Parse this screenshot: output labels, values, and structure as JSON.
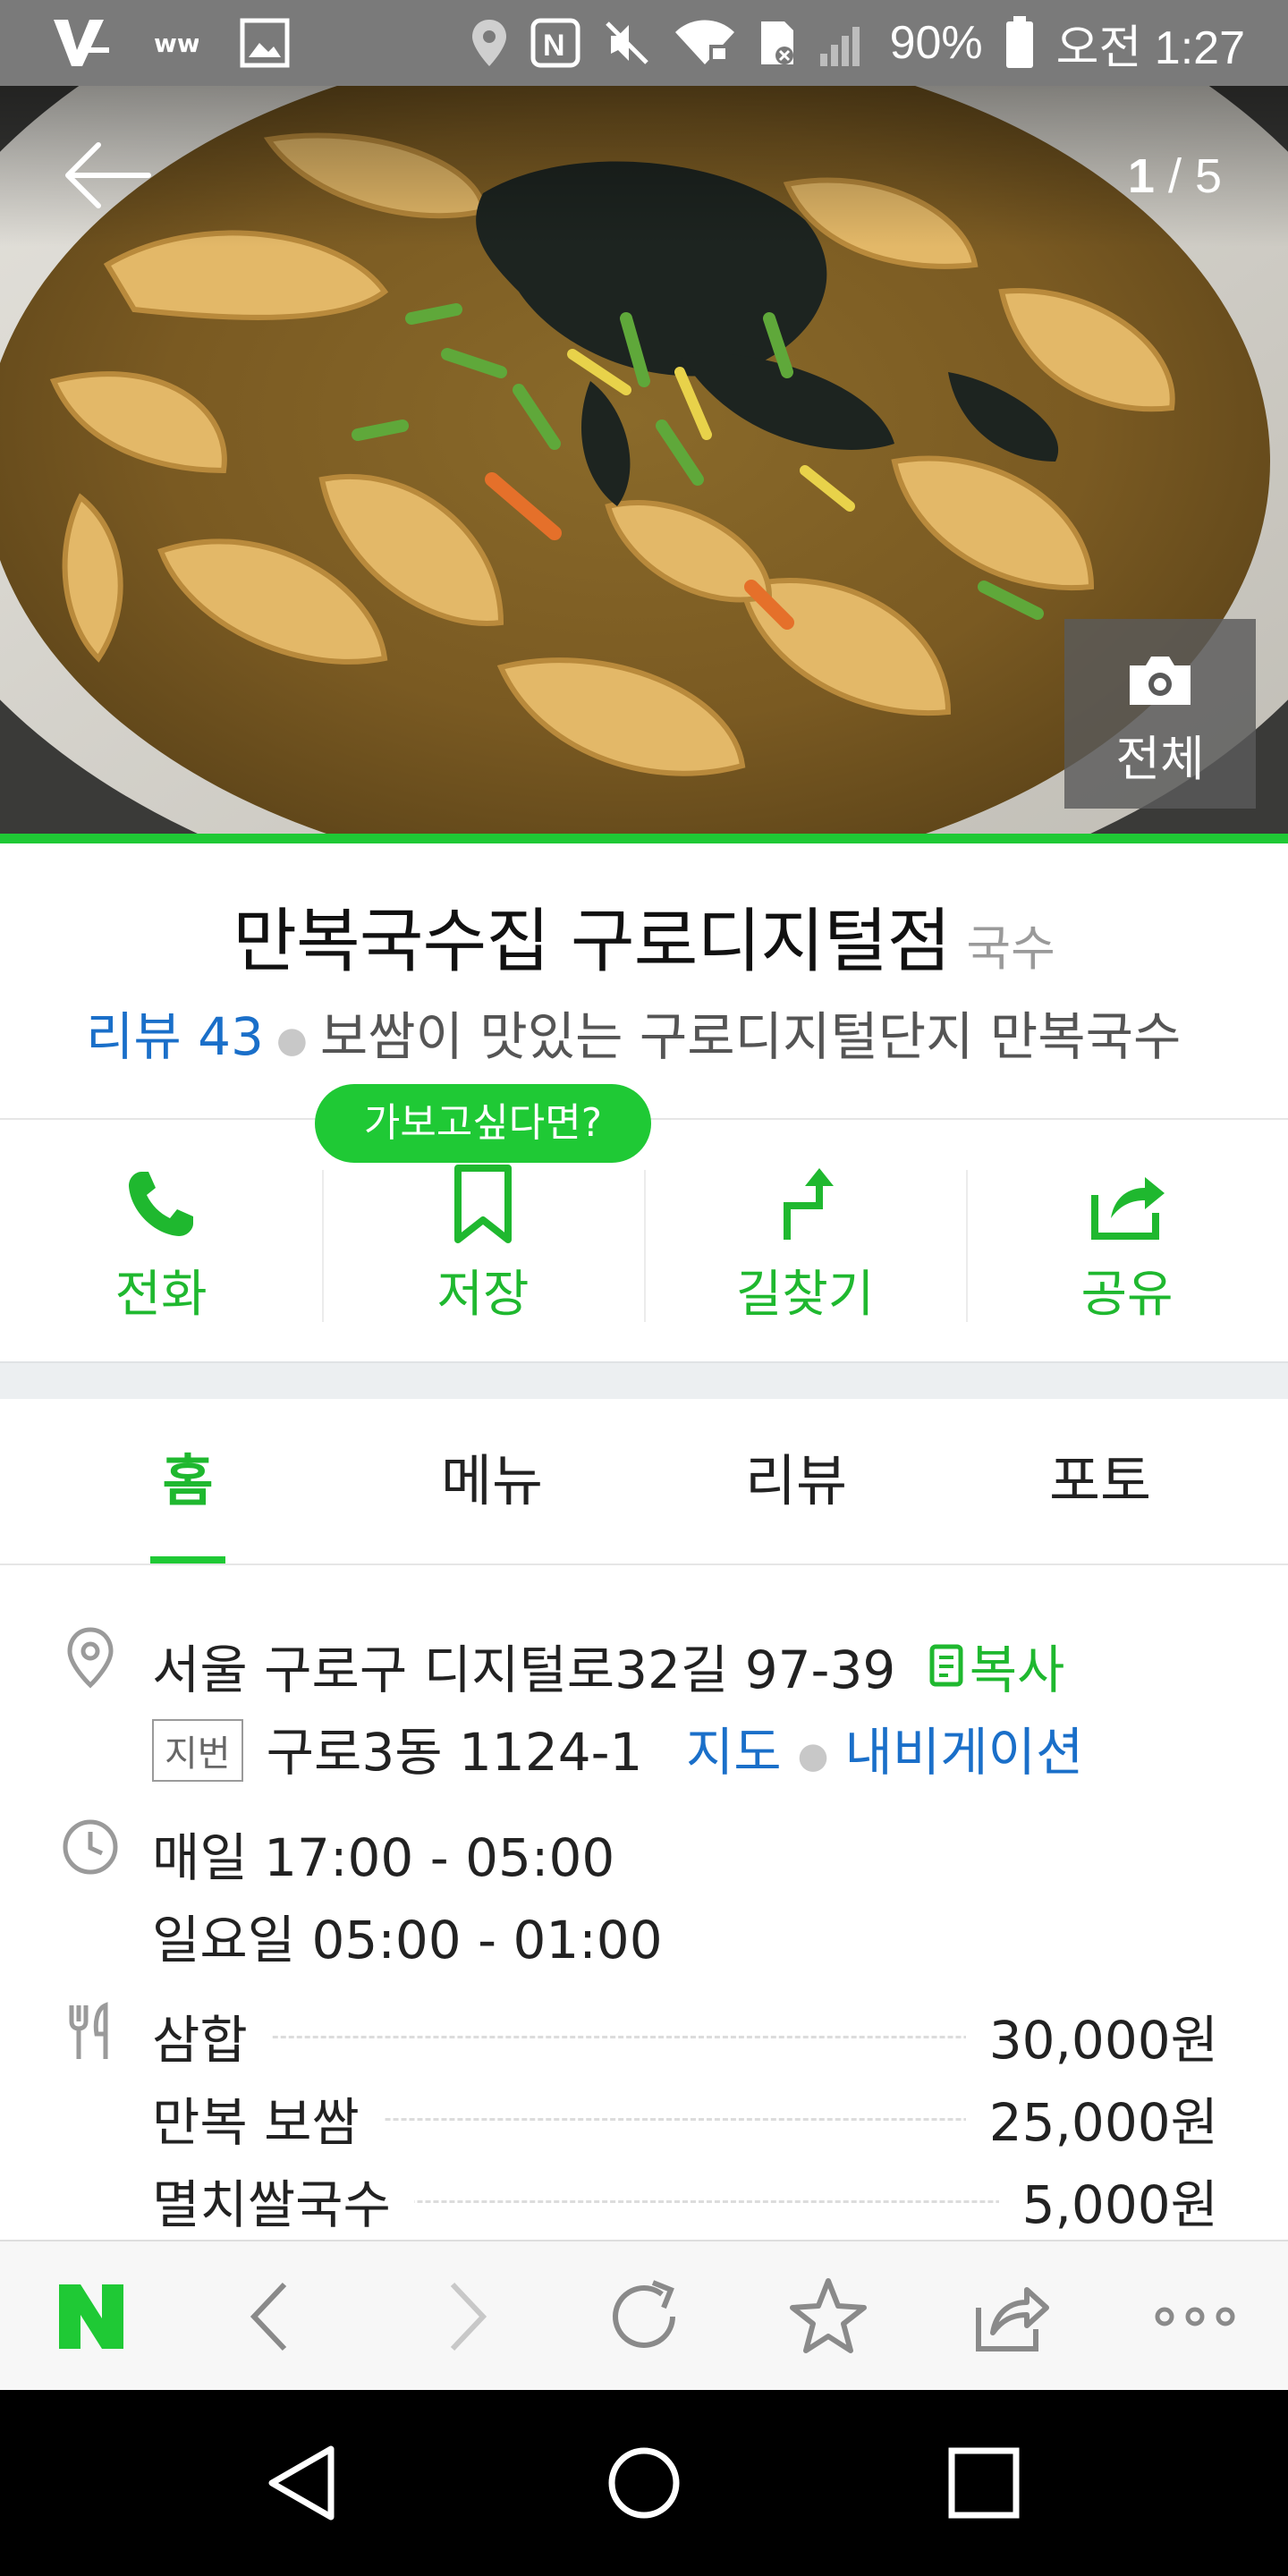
{
  "status_bar": {
    "battery_percent": "90%",
    "clock": "오전 1:27",
    "icons": [
      "v-app-icon",
      "w-app-icon",
      "image-icon",
      "location-icon",
      "nfc-icon",
      "mute-icon",
      "wifi-icon",
      "sim-icon",
      "signal-icon",
      "battery-icon"
    ]
  },
  "hero": {
    "counter_current": "1",
    "counter_sep": " / ",
    "counter_total": "5",
    "all_photos_label": "전체",
    "image_description_icon": "camera-icon"
  },
  "place": {
    "name": "만복국수집 구로디지털점",
    "category": "국수",
    "review_label": "리뷰 43",
    "review_snippet": "보쌈이 맛있는 구로디지털단지 만복국수"
  },
  "actions": {
    "wishlist_bubble": "가보고싶다면?",
    "items": [
      {
        "label": "전화",
        "icon": "phone-icon"
      },
      {
        "label": "저장",
        "icon": "bookmark-icon"
      },
      {
        "label": "길찾기",
        "icon": "directions-icon"
      },
      {
        "label": "공유",
        "icon": "share-icon"
      }
    ]
  },
  "tabs": [
    {
      "label": "홈",
      "active": true
    },
    {
      "label": "메뉴",
      "active": false
    },
    {
      "label": "리뷰",
      "active": false
    },
    {
      "label": "포토",
      "active": false
    }
  ],
  "info": {
    "address": "서울 구로구 디지털로32길 97-39",
    "copy_label": "복사",
    "jibun_badge": "지번",
    "jibun_address": "구로3동 1124-1",
    "map_link": "지도",
    "navigation_link": "내비게이션",
    "hours_line1": "매일 17:00 - 05:00",
    "hours_line2": "일요일 05:00 - 01:00",
    "menu": [
      {
        "name": "삼합",
        "price": "30,000원"
      },
      {
        "name": "만복 보쌈",
        "price": "25,000원"
      },
      {
        "name": "멸치쌀국수",
        "price": "5,000원"
      }
    ]
  },
  "colors": {
    "accent_green": "#1fc935",
    "link_blue": "#1a6fc9",
    "status_bar": "#7a7a7a"
  }
}
